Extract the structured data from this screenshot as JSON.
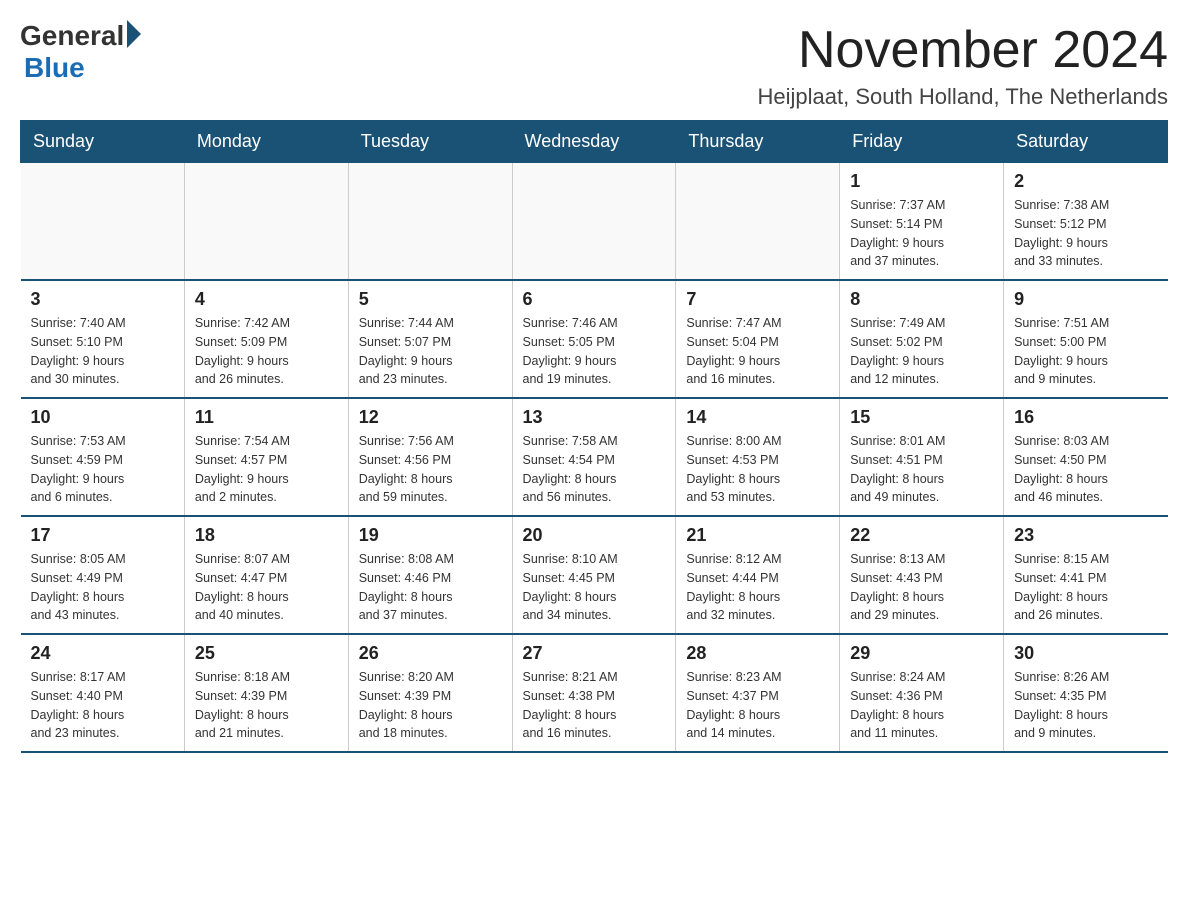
{
  "logo": {
    "general": "General",
    "blue": "Blue"
  },
  "title": "November 2024",
  "location": "Heijplaat, South Holland, The Netherlands",
  "weekdays": [
    "Sunday",
    "Monday",
    "Tuesday",
    "Wednesday",
    "Thursday",
    "Friday",
    "Saturday"
  ],
  "weeks": [
    [
      {
        "day": "",
        "info": ""
      },
      {
        "day": "",
        "info": ""
      },
      {
        "day": "",
        "info": ""
      },
      {
        "day": "",
        "info": ""
      },
      {
        "day": "",
        "info": ""
      },
      {
        "day": "1",
        "info": "Sunrise: 7:37 AM\nSunset: 5:14 PM\nDaylight: 9 hours\nand 37 minutes."
      },
      {
        "day": "2",
        "info": "Sunrise: 7:38 AM\nSunset: 5:12 PM\nDaylight: 9 hours\nand 33 minutes."
      }
    ],
    [
      {
        "day": "3",
        "info": "Sunrise: 7:40 AM\nSunset: 5:10 PM\nDaylight: 9 hours\nand 30 minutes."
      },
      {
        "day": "4",
        "info": "Sunrise: 7:42 AM\nSunset: 5:09 PM\nDaylight: 9 hours\nand 26 minutes."
      },
      {
        "day": "5",
        "info": "Sunrise: 7:44 AM\nSunset: 5:07 PM\nDaylight: 9 hours\nand 23 minutes."
      },
      {
        "day": "6",
        "info": "Sunrise: 7:46 AM\nSunset: 5:05 PM\nDaylight: 9 hours\nand 19 minutes."
      },
      {
        "day": "7",
        "info": "Sunrise: 7:47 AM\nSunset: 5:04 PM\nDaylight: 9 hours\nand 16 minutes."
      },
      {
        "day": "8",
        "info": "Sunrise: 7:49 AM\nSunset: 5:02 PM\nDaylight: 9 hours\nand 12 minutes."
      },
      {
        "day": "9",
        "info": "Sunrise: 7:51 AM\nSunset: 5:00 PM\nDaylight: 9 hours\nand 9 minutes."
      }
    ],
    [
      {
        "day": "10",
        "info": "Sunrise: 7:53 AM\nSunset: 4:59 PM\nDaylight: 9 hours\nand 6 minutes."
      },
      {
        "day": "11",
        "info": "Sunrise: 7:54 AM\nSunset: 4:57 PM\nDaylight: 9 hours\nand 2 minutes."
      },
      {
        "day": "12",
        "info": "Sunrise: 7:56 AM\nSunset: 4:56 PM\nDaylight: 8 hours\nand 59 minutes."
      },
      {
        "day": "13",
        "info": "Sunrise: 7:58 AM\nSunset: 4:54 PM\nDaylight: 8 hours\nand 56 minutes."
      },
      {
        "day": "14",
        "info": "Sunrise: 8:00 AM\nSunset: 4:53 PM\nDaylight: 8 hours\nand 53 minutes."
      },
      {
        "day": "15",
        "info": "Sunrise: 8:01 AM\nSunset: 4:51 PM\nDaylight: 8 hours\nand 49 minutes."
      },
      {
        "day": "16",
        "info": "Sunrise: 8:03 AM\nSunset: 4:50 PM\nDaylight: 8 hours\nand 46 minutes."
      }
    ],
    [
      {
        "day": "17",
        "info": "Sunrise: 8:05 AM\nSunset: 4:49 PM\nDaylight: 8 hours\nand 43 minutes."
      },
      {
        "day": "18",
        "info": "Sunrise: 8:07 AM\nSunset: 4:47 PM\nDaylight: 8 hours\nand 40 minutes."
      },
      {
        "day": "19",
        "info": "Sunrise: 8:08 AM\nSunset: 4:46 PM\nDaylight: 8 hours\nand 37 minutes."
      },
      {
        "day": "20",
        "info": "Sunrise: 8:10 AM\nSunset: 4:45 PM\nDaylight: 8 hours\nand 34 minutes."
      },
      {
        "day": "21",
        "info": "Sunrise: 8:12 AM\nSunset: 4:44 PM\nDaylight: 8 hours\nand 32 minutes."
      },
      {
        "day": "22",
        "info": "Sunrise: 8:13 AM\nSunset: 4:43 PM\nDaylight: 8 hours\nand 29 minutes."
      },
      {
        "day": "23",
        "info": "Sunrise: 8:15 AM\nSunset: 4:41 PM\nDaylight: 8 hours\nand 26 minutes."
      }
    ],
    [
      {
        "day": "24",
        "info": "Sunrise: 8:17 AM\nSunset: 4:40 PM\nDaylight: 8 hours\nand 23 minutes."
      },
      {
        "day": "25",
        "info": "Sunrise: 8:18 AM\nSunset: 4:39 PM\nDaylight: 8 hours\nand 21 minutes."
      },
      {
        "day": "26",
        "info": "Sunrise: 8:20 AM\nSunset: 4:39 PM\nDaylight: 8 hours\nand 18 minutes."
      },
      {
        "day": "27",
        "info": "Sunrise: 8:21 AM\nSunset: 4:38 PM\nDaylight: 8 hours\nand 16 minutes."
      },
      {
        "day": "28",
        "info": "Sunrise: 8:23 AM\nSunset: 4:37 PM\nDaylight: 8 hours\nand 14 minutes."
      },
      {
        "day": "29",
        "info": "Sunrise: 8:24 AM\nSunset: 4:36 PM\nDaylight: 8 hours\nand 11 minutes."
      },
      {
        "day": "30",
        "info": "Sunrise: 8:26 AM\nSunset: 4:35 PM\nDaylight: 8 hours\nand 9 minutes."
      }
    ]
  ]
}
